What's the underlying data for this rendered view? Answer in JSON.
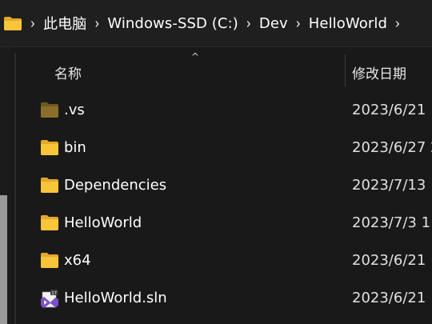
{
  "breadcrumb": {
    "items": [
      "此电脑",
      "Windows-SSD (C:)",
      "Dev",
      "HelloWorld"
    ],
    "separator": "›"
  },
  "header": {
    "name_label": "名称",
    "date_label": "修改日期",
    "sort_indicator": "^"
  },
  "files": [
    {
      "name": ".vs",
      "date": "2023/6/21",
      "icon": "folder-hidden-icon"
    },
    {
      "name": "bin",
      "date": "2023/6/27 2",
      "icon": "folder-icon"
    },
    {
      "name": "Dependencies",
      "date": "2023/7/13",
      "icon": "folder-icon"
    },
    {
      "name": "HelloWorld",
      "date": "2023/7/3 1",
      "icon": "folder-icon"
    },
    {
      "name": "x64",
      "date": "2023/6/21",
      "icon": "folder-icon"
    },
    {
      "name": "HelloWorld.sln",
      "date": "2023/6/21",
      "icon": "visual-studio-solution-icon"
    }
  ],
  "colors": {
    "background": "#191919",
    "folder": "#f8c53a",
    "folder_hidden": "#8a6f2a",
    "vs_purple": "#7b4fc9"
  }
}
